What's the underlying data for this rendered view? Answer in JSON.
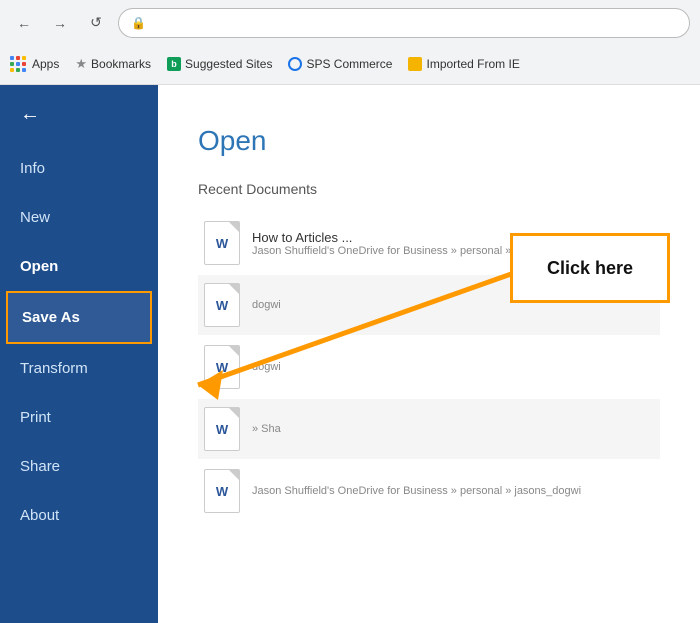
{
  "browser": {
    "back_label": "←",
    "forward_label": "→",
    "refresh_label": "↺",
    "address_bar_value": "",
    "bookmarks": [
      {
        "name": "Apps",
        "type": "apps"
      },
      {
        "name": "Bookmarks",
        "type": "star"
      },
      {
        "name": "Suggested Sites",
        "type": "green",
        "color": "#0f9d58"
      },
      {
        "name": "SPS Commerce",
        "type": "circle",
        "color": "#1a73e8"
      },
      {
        "name": "Imported From IE",
        "type": "yellow",
        "color": "#f4b400"
      }
    ]
  },
  "sidebar": {
    "back_arrow": "←",
    "items": [
      {
        "label": "Info",
        "state": "normal"
      },
      {
        "label": "New",
        "state": "normal"
      },
      {
        "label": "Open",
        "state": "active"
      },
      {
        "label": "Save As",
        "state": "highlighted"
      },
      {
        "label": "Transform",
        "state": "normal"
      },
      {
        "label": "Print",
        "state": "normal"
      },
      {
        "label": "Share",
        "state": "normal"
      },
      {
        "label": "About",
        "state": "normal"
      }
    ]
  },
  "main": {
    "title": "Open",
    "recent_label": "Recent Documents",
    "click_here_label": "Click here",
    "documents": [
      {
        "name": "How to Articles ...",
        "path": "Jason Shuffield's OneDrive for Business » personal » jasons_dogwi"
      },
      {
        "name": "",
        "path": "dogwi"
      },
      {
        "name": "",
        "path": "dogwi"
      },
      {
        "name": "",
        "path": "» Sha"
      },
      {
        "name": "",
        "path": "Jason Shuffield's OneDrive for Business » personal » jasons_dogwi"
      }
    ]
  }
}
